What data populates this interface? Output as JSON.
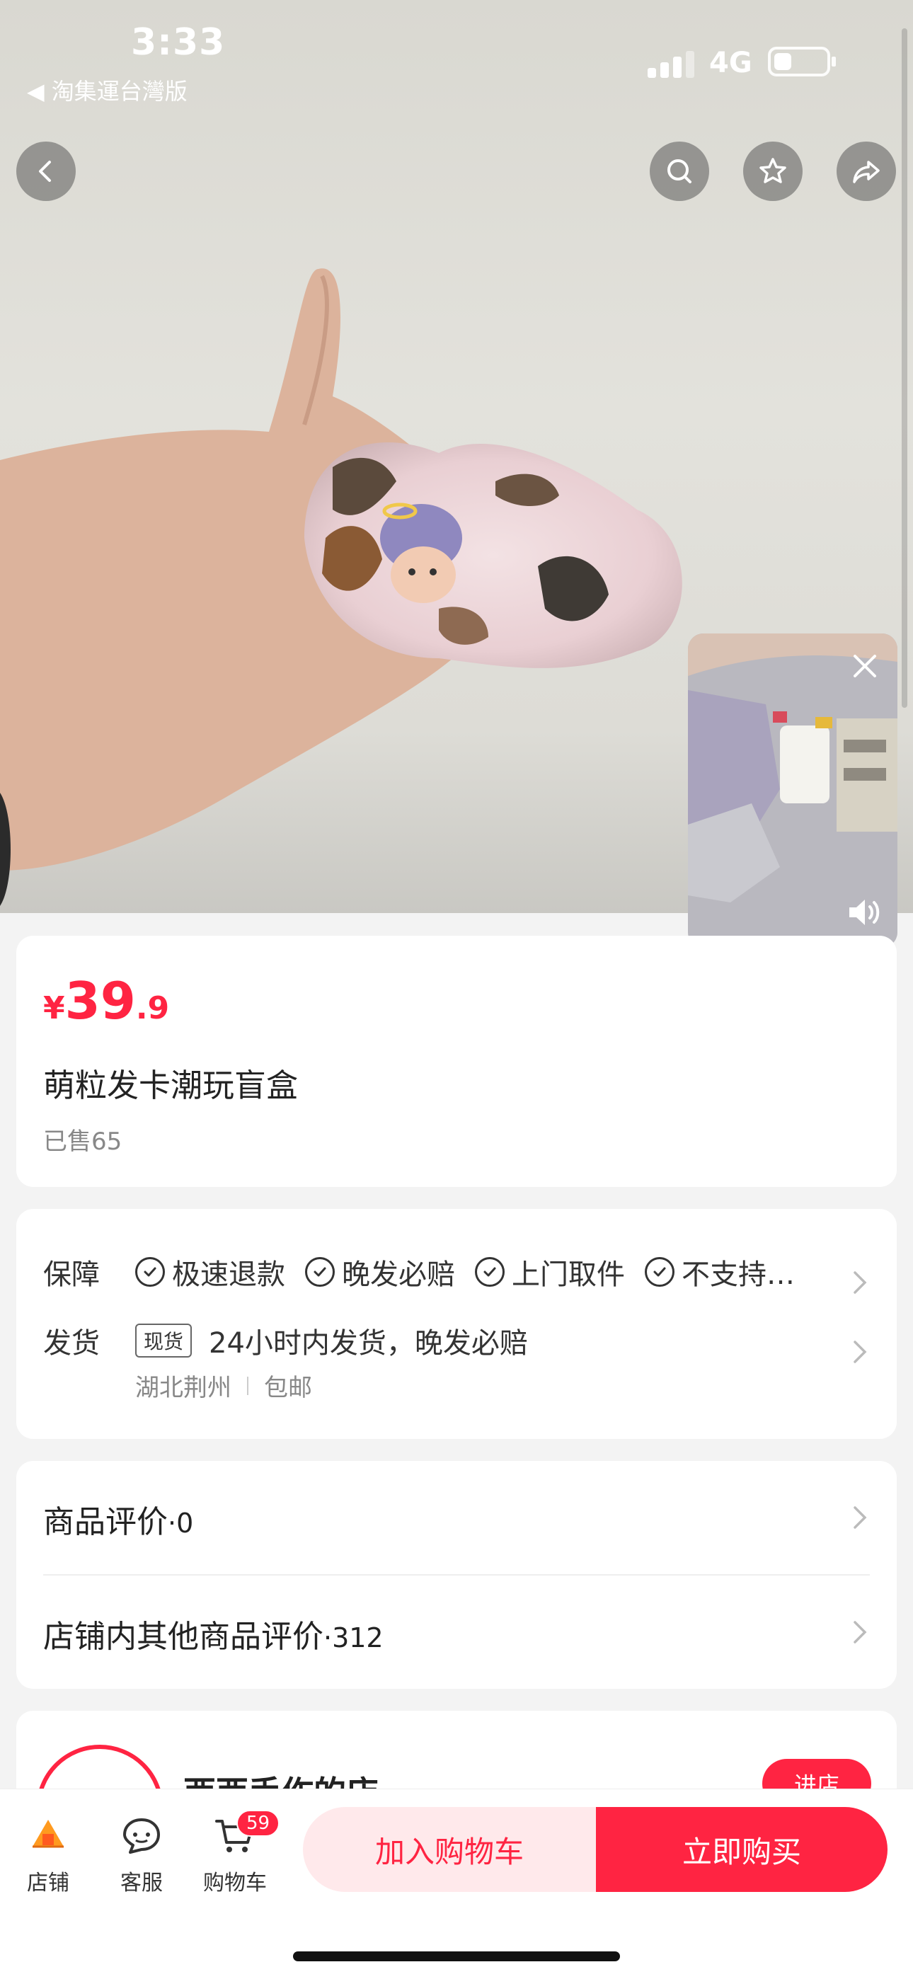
{
  "status_bar": {
    "time": "3:33",
    "back_app": "◀ 淘集運台灣版",
    "network": "4G"
  },
  "product": {
    "currency": "¥",
    "price_int": "39",
    "price_dec": ".9",
    "title": "萌粒发卡潮玩盲盒",
    "sold": "已售65"
  },
  "service": {
    "guarantee_label": "保障",
    "guarantees": [
      "极速退款",
      "晚发必赔",
      "上门取件",
      "不支持…"
    ],
    "shipping_label": "发货",
    "shipping_tag": "现货",
    "shipping_text": "24小时内发货，晚发必赔",
    "origin": "湖北荆州",
    "postage": "包邮"
  },
  "reviews": {
    "product_label": "商品评价",
    "product_count": "·0",
    "shop_label": "店铺内其他商品评价",
    "shop_count": "·312"
  },
  "shop": {
    "name": "西西手作的店",
    "enter": "进店"
  },
  "bottom_bar": {
    "shop": "店铺",
    "service": "客服",
    "cart": "购物车",
    "cart_badge": "59",
    "add_to_cart": "加入购物车",
    "buy_now": "立即购买"
  },
  "colors": {
    "accent": "#ff2442",
    "accent_light": "#ffe9eb",
    "background": "#f3f3f3"
  },
  "icons": [
    "back-icon",
    "search-icon",
    "star-icon",
    "share-icon",
    "close-icon",
    "sound-icon",
    "check-icon",
    "chevron-right-icon",
    "shop-icon",
    "chat-icon",
    "cart-icon"
  ]
}
